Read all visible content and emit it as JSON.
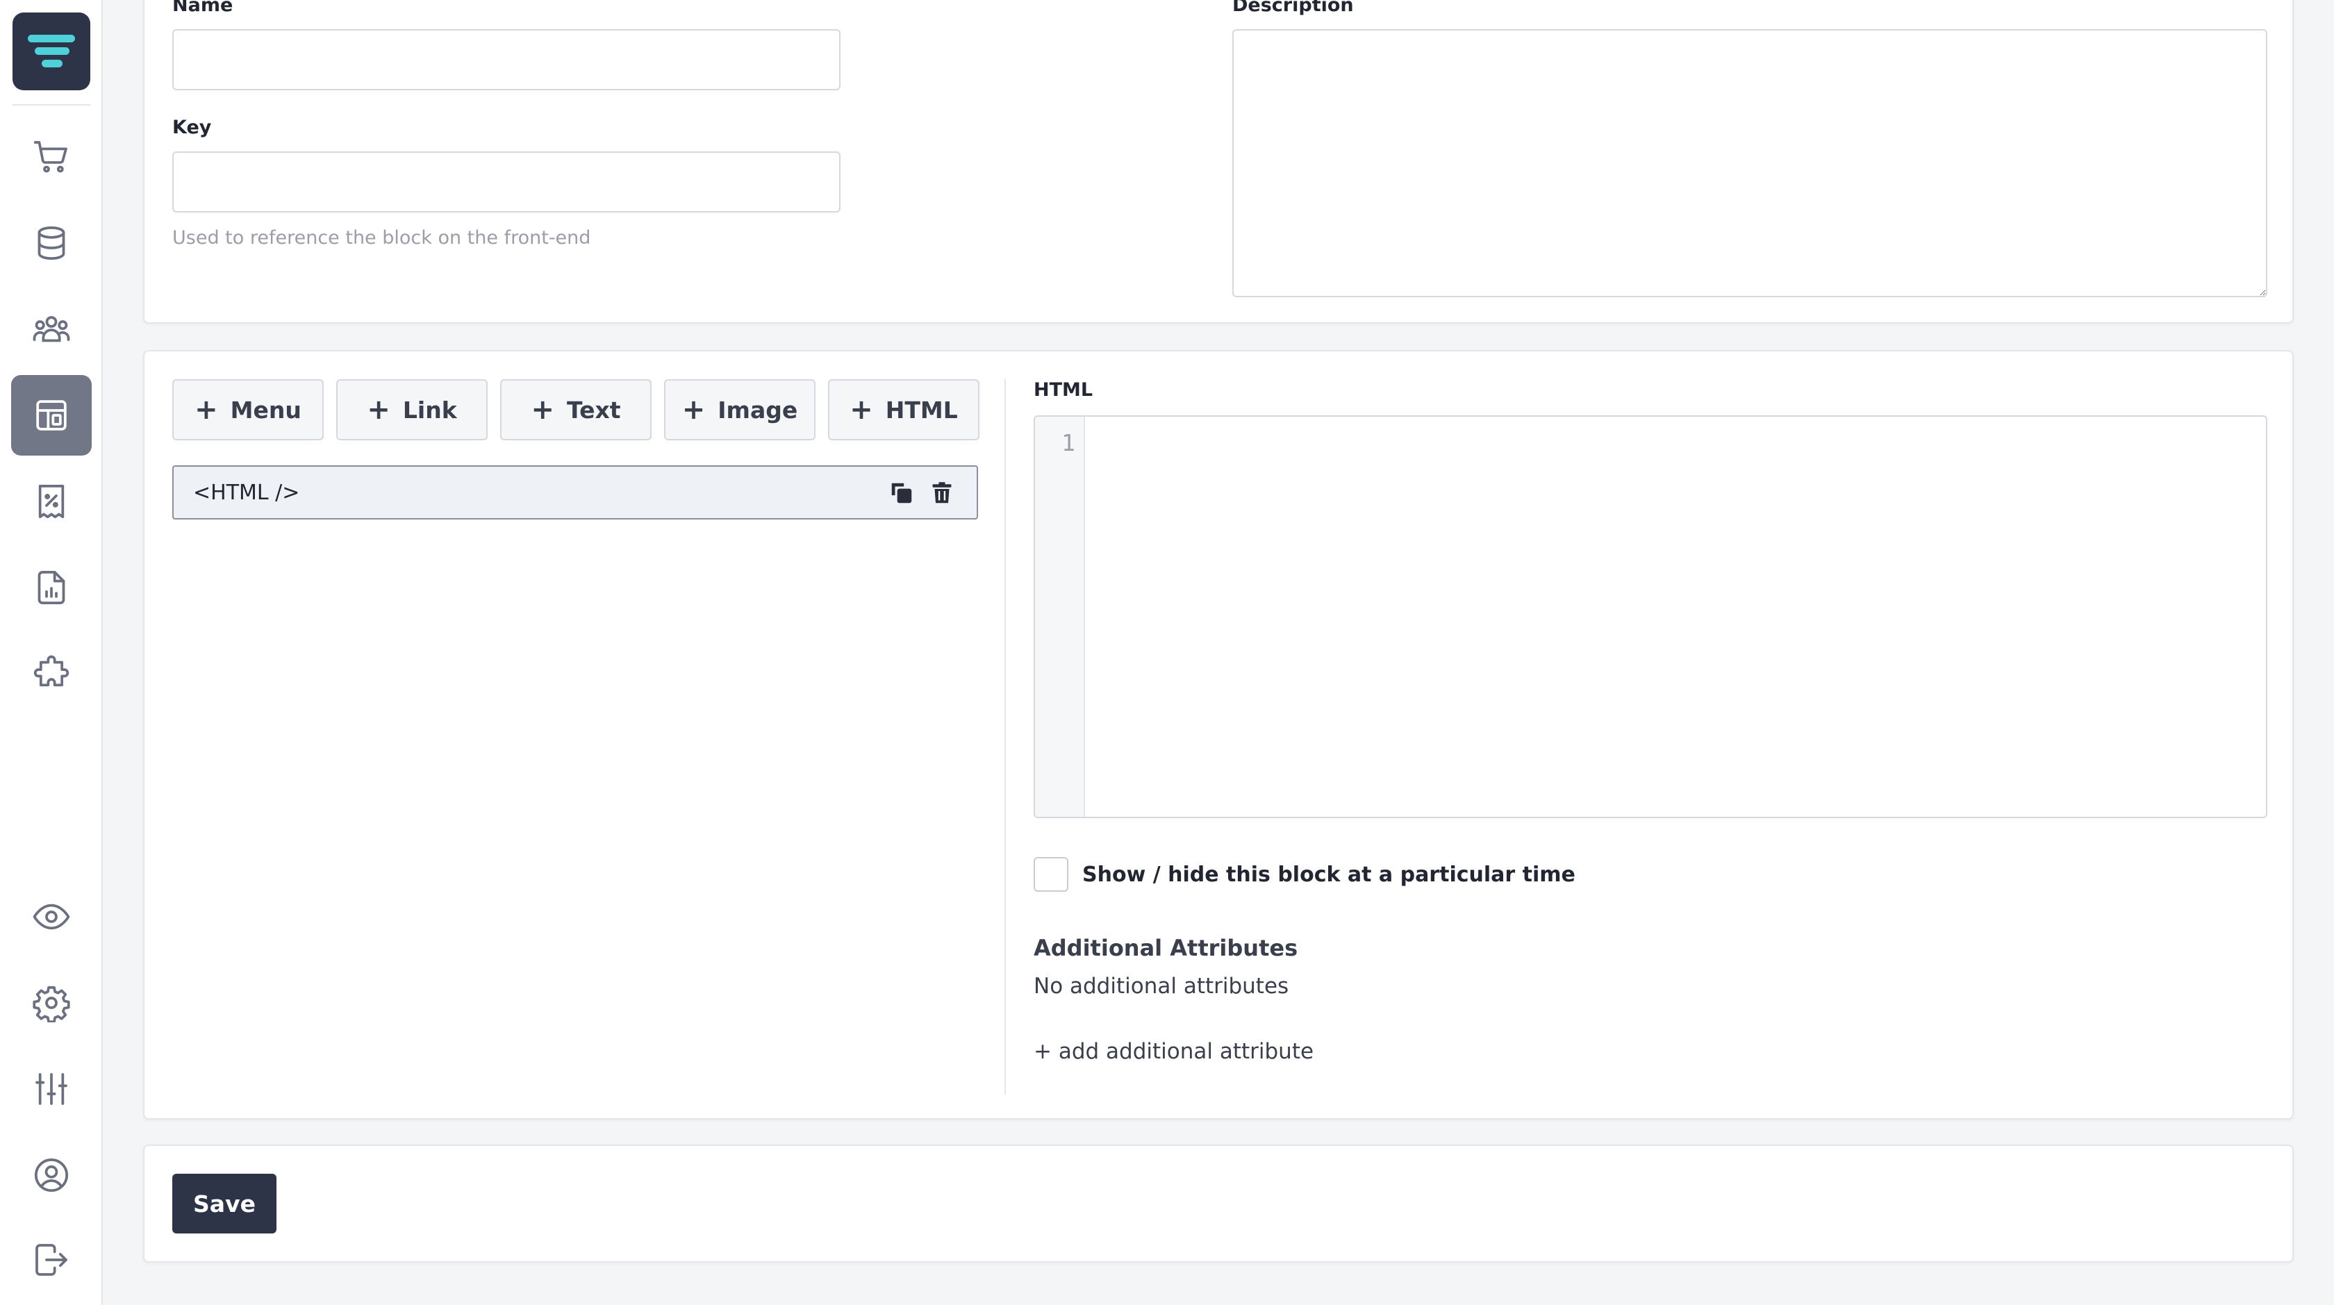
{
  "colors": {
    "brand_dark": "#2e3447",
    "logo_accent": "#4fd1d9",
    "active_nav": "#727788",
    "icon_gray": "#6b7080"
  },
  "sidebar": {
    "items": [
      {
        "icon": "shopping-cart-icon",
        "active": false
      },
      {
        "icon": "database-icon",
        "active": false
      },
      {
        "icon": "users-group-icon",
        "active": false
      },
      {
        "icon": "layout-icon",
        "active": true
      },
      {
        "icon": "discount-receipt-icon",
        "active": false
      },
      {
        "icon": "report-icon",
        "active": false
      },
      {
        "icon": "puzzle-icon",
        "active": false
      },
      {
        "icon": "eye-icon",
        "active": false
      },
      {
        "icon": "gear-icon",
        "active": false
      },
      {
        "icon": "sliders-icon",
        "active": false
      },
      {
        "icon": "user-circle-icon",
        "active": false
      },
      {
        "icon": "logout-icon",
        "active": false
      }
    ]
  },
  "details": {
    "name_label": "Name",
    "name_value": "",
    "key_label": "Key",
    "key_value": "",
    "key_hint": "Used to reference the block on the front-end",
    "description_label": "Description",
    "description_value": ""
  },
  "builder": {
    "add_buttons": [
      {
        "label": "Menu"
      },
      {
        "label": "Link"
      },
      {
        "label": "Text"
      },
      {
        "label": "Image"
      },
      {
        "label": "HTML"
      }
    ],
    "blocks": [
      {
        "tag": "<HTML />"
      }
    ]
  },
  "editor": {
    "html_label": "HTML",
    "line_number": "1",
    "schedule_label": "Show / hide this block at a particular time",
    "schedule_checked": false,
    "attributes_title": "Additional Attributes",
    "attributes_empty": "No additional attributes",
    "add_attribute_link": "+ add additional attribute"
  },
  "footer": {
    "save_label": "Save"
  }
}
